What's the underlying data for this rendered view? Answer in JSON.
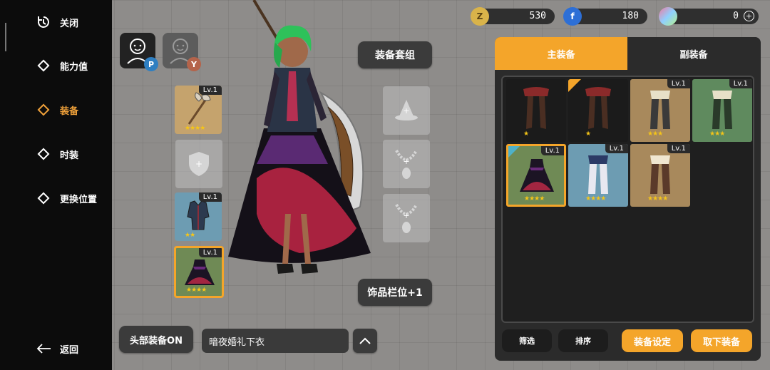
{
  "nav": {
    "items": [
      {
        "label": "关闭",
        "icon": "close-rotate-icon"
      },
      {
        "label": "能力值",
        "icon": "diamond-icon"
      },
      {
        "label": "装备",
        "icon": "diamond-icon",
        "active": true
      },
      {
        "label": "时装",
        "icon": "diamond-icon"
      },
      {
        "label": "更换位置",
        "icon": "diamond-icon"
      }
    ],
    "back_label": "返回"
  },
  "avatars": {
    "p_badge": "P",
    "y_badge": "Y"
  },
  "equip_set_label": "装备套组",
  "accessory_slot_label": "饰品栏位+1",
  "head_equip_label": "头部装备ON",
  "item_name": "暗夜婚礼下衣",
  "currency": {
    "gold": "530",
    "gem": "180",
    "crystal": "0"
  },
  "left_slots": [
    {
      "level": "Lv.1",
      "stars": "★★★★"
    },
    {
      "level": "",
      "stars": ""
    },
    {
      "level": "Lv.1",
      "stars": "★★"
    },
    {
      "level": "Lv.1",
      "stars": "★★★★"
    }
  ],
  "tabs": {
    "main": "主装备",
    "sub": "副装备"
  },
  "grid_items": [
    {
      "level": "",
      "stars": "★"
    },
    {
      "level": "",
      "stars": "★"
    },
    {
      "level": "Lv.1",
      "stars": "★★★"
    },
    {
      "level": "Lv.1",
      "stars": "★★★"
    },
    {
      "level": "Lv.1",
      "stars": "★★★★"
    },
    {
      "level": "Lv.1",
      "stars": "★★★★"
    },
    {
      "level": "Lv.1",
      "stars": "★★★★"
    }
  ],
  "buttons": {
    "filter": "筛选",
    "sort": "排序",
    "equip_setting": "装备设定",
    "unequip": "取下装备"
  },
  "colors": {
    "accent": "#f4a52a",
    "nav_bg": "#0c0c0c",
    "panel_bg": "#2b2b2b"
  }
}
